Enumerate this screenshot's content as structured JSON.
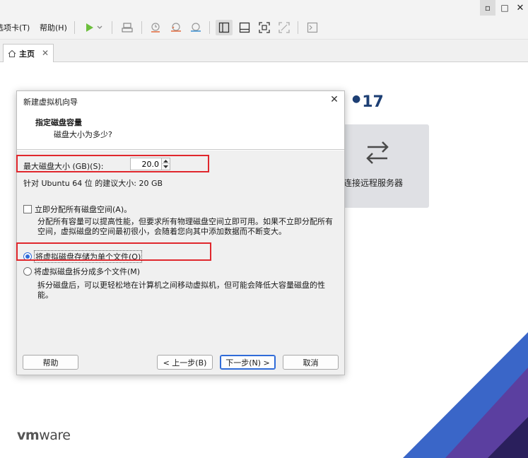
{
  "titlebar": {
    "controls": {
      "minimize": "▫",
      "maximize": "□",
      "close": "✕"
    }
  },
  "menubar": {
    "items": [
      {
        "label": "选项卡(T)"
      },
      {
        "label": "帮助(H)"
      }
    ],
    "toolbar_icons": [
      "play-icon",
      "dropdown-arrow-icon",
      "send-keys-icon",
      "snapshot-take-icon",
      "snapshot-revert-icon",
      "snapshot-manager-icon",
      "sidebar-view-icon",
      "thumbnail-view-icon",
      "fullscreen-icon",
      "unity-icon",
      "console-icon"
    ]
  },
  "tabs": [
    {
      "label": "主页",
      "icon": "home-icon",
      "close": "✕"
    }
  ],
  "home": {
    "product_suffix": "17",
    "remote_card_label": "连接远程服务器",
    "logo_vm": "vm",
    "logo_ware": "ware"
  },
  "dialog": {
    "title": "新建虚拟机向导",
    "close": "✕",
    "header_title": "指定磁盘容量",
    "header_subtitle": "磁盘大小为多少?",
    "max_size_label": "最大磁盘大小 (GB)(S):",
    "max_size_value": "20.0",
    "recommended": "针对 Ubuntu 64 位 的建议大小: 20 GB",
    "allocate_label": "立即分配所有磁盘空间(A)。",
    "allocate_checked": false,
    "allocate_desc": "分配所有容量可以提高性能，但要求所有物理磁盘空间立即可用。如果不立即分配所有空间，虚拟磁盘的空间最初很小，会随着您向其中添加数据而不断变大。",
    "single_file_label": "将虚拟磁盘存储为单个文件(O)",
    "multi_file_label": "将虚拟磁盘拆分成多个文件(M)",
    "selected_option": "single",
    "multi_file_desc": "拆分磁盘后，可以更轻松地在计算机之间移动虚拟机，但可能会降低大容量磁盘的性能。",
    "buttons": {
      "help": "帮助",
      "back": "< 上一步(B)",
      "next": "下一步(N) >",
      "cancel": "取消"
    }
  },
  "colors": {
    "highlight": "#e0272d",
    "accent": "#2f6bd8",
    "brand": "#1d3f74",
    "corner_purple": "#5b3fa0",
    "corner_blue": "#3a66c8"
  }
}
